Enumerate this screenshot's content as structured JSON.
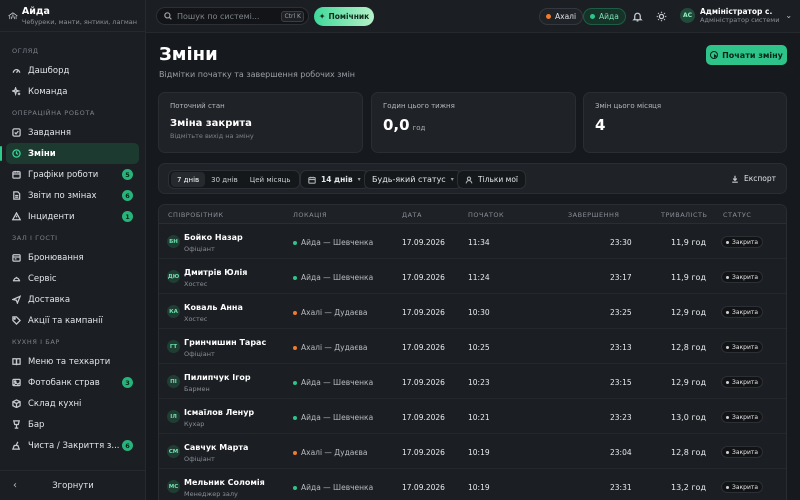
{
  "brand": {
    "title": "Айда",
    "subtitle": "Чебуреки, манти, янтики, лагман"
  },
  "colors": {
    "accent": "#2ec489",
    "location_shevchenka": "#2ec489",
    "location_dudaeva": "#f07b2c"
  },
  "sidebar": {
    "sections": [
      {
        "title": "Огляд",
        "items": [
          {
            "label": "Дашборд",
            "icon": "gauge-icon"
          },
          {
            "label": "Команда",
            "icon": "sparkle-icon"
          }
        ]
      },
      {
        "title": "Операційна робота",
        "items": [
          {
            "label": "Завдання",
            "icon": "checkbox-icon"
          },
          {
            "label": "Зміни",
            "icon": "clock-icon",
            "active": true
          },
          {
            "label": "Графіки роботи",
            "icon": "calendar-icon",
            "badge": "5"
          },
          {
            "label": "Звіти по змінах",
            "icon": "report-icon",
            "badge": "6"
          },
          {
            "label": "Інциденти",
            "icon": "alert-icon",
            "badge": "1"
          }
        ]
      },
      {
        "title": "Зал і гості",
        "items": [
          {
            "label": "Бронювання",
            "icon": "booking-icon"
          },
          {
            "label": "Сервіс",
            "icon": "service-icon"
          },
          {
            "label": "Доставка",
            "icon": "send-icon"
          },
          {
            "label": "Акції та кампанії",
            "icon": "tag-icon"
          }
        ]
      },
      {
        "title": "Кухня і бар",
        "items": [
          {
            "label": "Меню та техкарти",
            "icon": "book-icon"
          },
          {
            "label": "Фотобанк страв",
            "icon": "image-icon",
            "badge": "3"
          },
          {
            "label": "Склад кухні",
            "icon": "box-icon"
          },
          {
            "label": "Бар",
            "icon": "glass-icon"
          },
          {
            "label": "Чиста / Закриття з...",
            "icon": "broom-icon",
            "badge": "6"
          }
        ]
      }
    ],
    "collapse_label": "Згорнути"
  },
  "topbar": {
    "search_placeholder": "Пошук по системі...",
    "search_shortcut": "Ctrl K",
    "helper_label": "Помічник",
    "locations": [
      {
        "label": "Ахалі",
        "color": "#f07b2c",
        "active": false
      },
      {
        "label": "Айда",
        "color": "#2ec489",
        "active": true
      }
    ],
    "user": {
      "initials": "АС",
      "name": "Адміністратор с.",
      "role": "Адміністратор системи"
    }
  },
  "page": {
    "title": "Зміни",
    "subtitle": "Відмітки початку та завершення робочих змін",
    "start_button": "Почати зміну"
  },
  "cards": [
    {
      "label": "Поточний стан",
      "value": "Зміна закрита",
      "hint": "Відмітьте вихід на зміну"
    },
    {
      "label": "Годин цього тижня",
      "value": "0,0",
      "unit": "год"
    },
    {
      "label": "Змін цього місяця",
      "value": "4"
    }
  ],
  "filters": {
    "periods": [
      {
        "label": "7 днів",
        "selected": true
      },
      {
        "label": "30 днів",
        "selected": false
      },
      {
        "label": "Цей місяць",
        "selected": false
      }
    ],
    "range_label": "14 днів",
    "status_label": "Будь-який статус",
    "mine_label": "Тільки мої",
    "export_label": "Експорт"
  },
  "table": {
    "columns": [
      "Співробітник",
      "Локація",
      "Дата",
      "Початок",
      "Завершення",
      "Тривалість",
      "Статус"
    ],
    "rows": [
      {
        "initials": "БН",
        "name": "Бойко Назар",
        "role": "Офіціант",
        "location": "Айда — Шевченка",
        "loc_color": "#2ec489",
        "date": "17.09.2026",
        "start": "11:34",
        "end": "23:30",
        "duration": "11,9 год",
        "status": "Закрита"
      },
      {
        "initials": "ДЮ",
        "name": "Дмитрів Юлія",
        "role": "Хостес",
        "location": "Айда — Шевченка",
        "loc_color": "#2ec489",
        "date": "17.09.2026",
        "start": "11:24",
        "end": "23:17",
        "duration": "11,9 год",
        "status": "Закрита"
      },
      {
        "initials": "КА",
        "name": "Коваль Анна",
        "role": "Хостес",
        "location": "Ахалі — Дудаєва",
        "loc_color": "#f07b2c",
        "date": "17.09.2026",
        "start": "10:30",
        "end": "23:25",
        "duration": "12,9 год",
        "status": "Закрита"
      },
      {
        "initials": "ГТ",
        "name": "Гринчишин Тарас",
        "role": "Офіціант",
        "location": "Ахалі — Дудаєва",
        "loc_color": "#f07b2c",
        "date": "17.09.2026",
        "start": "10:25",
        "end": "23:13",
        "duration": "12,8 год",
        "status": "Закрита"
      },
      {
        "initials": "ПІ",
        "name": "Пилипчук Ігор",
        "role": "Бармен",
        "location": "Айда — Шевченка",
        "loc_color": "#2ec489",
        "date": "17.09.2026",
        "start": "10:23",
        "end": "23:15",
        "duration": "12,9 год",
        "status": "Закрита"
      },
      {
        "initials": "ІЛ",
        "name": "Ісмаїлов Ленур",
        "role": "Кухар",
        "location": "Айда — Шевченка",
        "loc_color": "#2ec489",
        "date": "17.09.2026",
        "start": "10:21",
        "end": "23:23",
        "duration": "13,0 год",
        "status": "Закрита"
      },
      {
        "initials": "СМ",
        "name": "Савчук Марта",
        "role": "Офіціант",
        "location": "Ахалі — Дудаєва",
        "loc_color": "#f07b2c",
        "date": "17.09.2026",
        "start": "10:19",
        "end": "23:04",
        "duration": "12,8 год",
        "status": "Закрита"
      },
      {
        "initials": "МС",
        "name": "Мельник Соломія",
        "role": "Менеджер залу",
        "location": "Айда — Шевченка",
        "loc_color": "#2ec489",
        "date": "17.09.2026",
        "start": "10:19",
        "end": "23:31",
        "duration": "13,2 год",
        "status": "Закрита"
      }
    ]
  }
}
